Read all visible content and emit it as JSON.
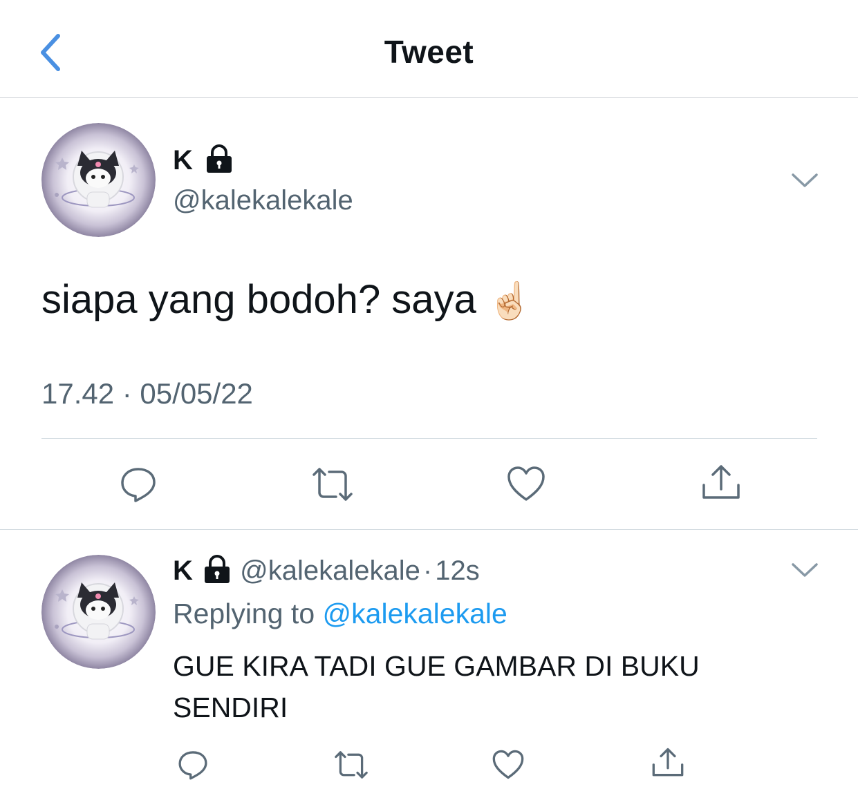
{
  "header": {
    "title": "Tweet",
    "back_icon": "chevron-left-icon",
    "accent_color": "#4a90e2"
  },
  "tweet": {
    "display_name": "K",
    "handle": "@kalekalekale",
    "text": "siapa yang bodoh? saya",
    "emoji": "☝🏻",
    "timestamp": "17.42 · 05/05/22",
    "actions": [
      "reply-icon",
      "retweet-icon",
      "like-icon",
      "share-icon"
    ]
  },
  "reply": {
    "display_name": "K",
    "handle": "@kalekalekale",
    "separator": "·",
    "time": "12s",
    "replying_prefix": "Replying to",
    "replying_to": "@kalekalekale",
    "text": "GUE KIRA TADI GUE GAMBAR DI BUKU SENDIRI",
    "actions": [
      "reply-icon",
      "retweet-icon",
      "like-icon",
      "share-icon"
    ]
  },
  "colors": {
    "text": "#0f1419",
    "secondary": "#536471",
    "link": "#1d9bf0",
    "icon": "#5b6b78"
  }
}
